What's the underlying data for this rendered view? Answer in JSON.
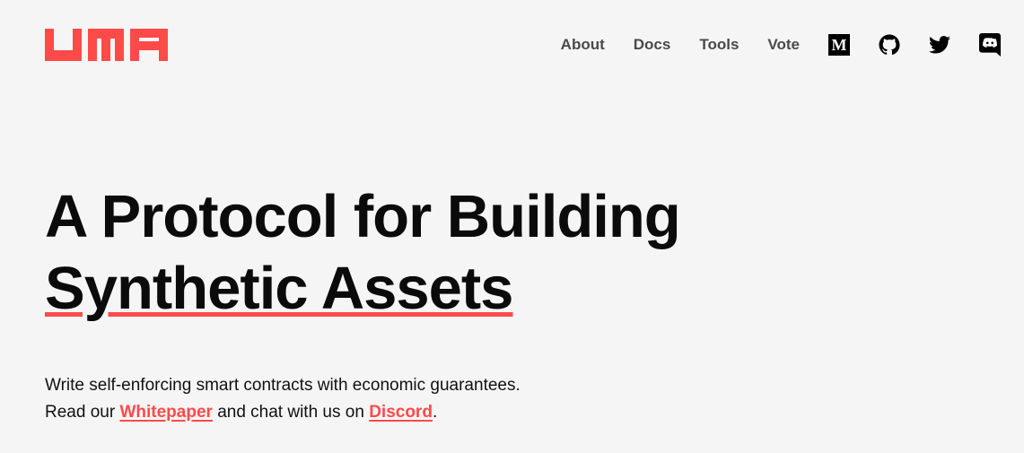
{
  "brand": {
    "logo_text": "UMA",
    "accent_color": "#ff4a4a"
  },
  "nav": {
    "links": [
      "About",
      "Docs",
      "Tools",
      "Vote"
    ],
    "icons": [
      "medium-icon",
      "github-icon",
      "twitter-icon",
      "discord-icon"
    ],
    "medium_letter": "M"
  },
  "hero": {
    "line1": "A Protocol for Building",
    "line2": "Synthetic Assets"
  },
  "sub": {
    "line1": "Write self-enforcing smart contracts with economic guarantees.",
    "read_our": "Read our",
    "whitepaper_link": "Whitepaper",
    "middle": "and chat with us on",
    "discord_link": "Discord",
    "end": "."
  }
}
